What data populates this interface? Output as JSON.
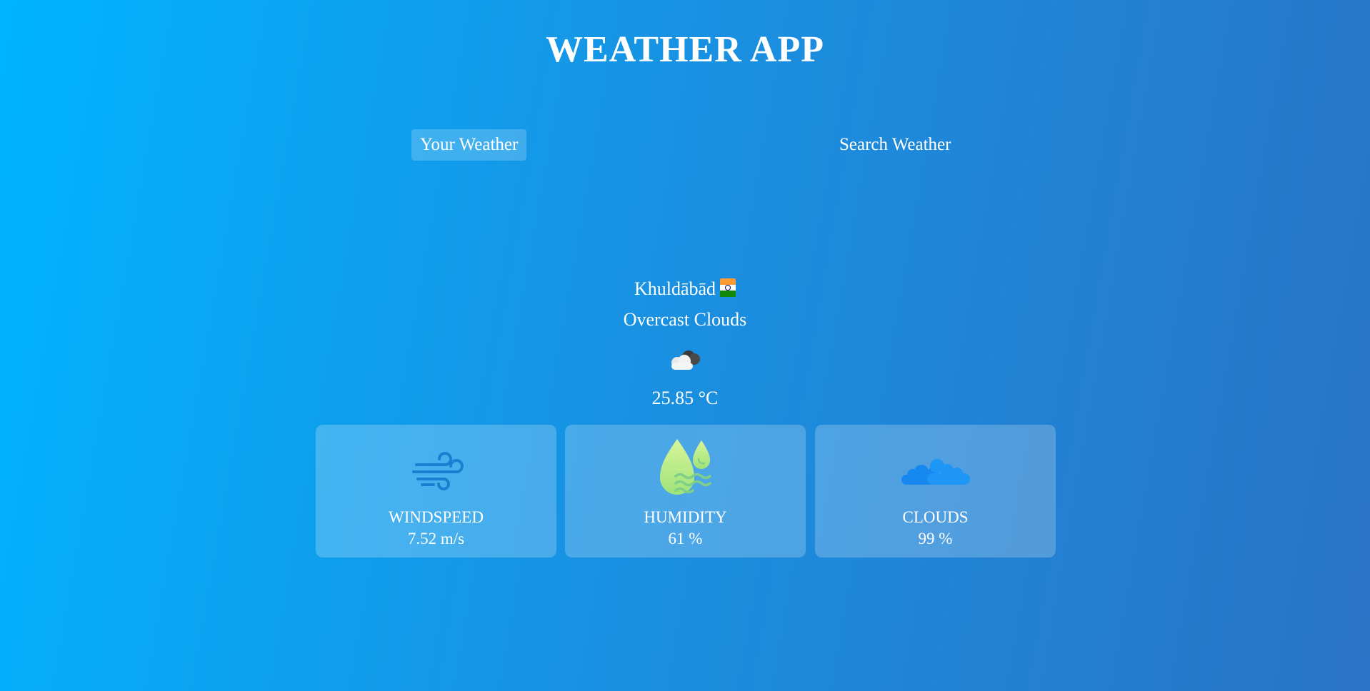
{
  "header": {
    "title": "WEATHER APP"
  },
  "tabs": [
    {
      "label": "Your Weather",
      "active": true
    },
    {
      "label": "Search Weather",
      "active": false
    }
  ],
  "current": {
    "city": "Khuldābād",
    "country_flag_icon": "india-flag-icon",
    "description": "Overcast Clouds",
    "condition_icon": "overcast-clouds-icon",
    "temperature": "25.85 °C"
  },
  "stats": [
    {
      "label": "WINDSPEED",
      "value": "7.52 m/s",
      "icon": "wind-icon"
    },
    {
      "label": "HUMIDITY",
      "value": "61 %",
      "icon": "humidity-drops-icon"
    },
    {
      "label": "CLOUDS",
      "value": "99 %",
      "icon": "clouds-icon"
    }
  ],
  "colors": {
    "background_start": "#00b4ff",
    "background_end": "#2a73c6",
    "text": "#ffffff"
  }
}
